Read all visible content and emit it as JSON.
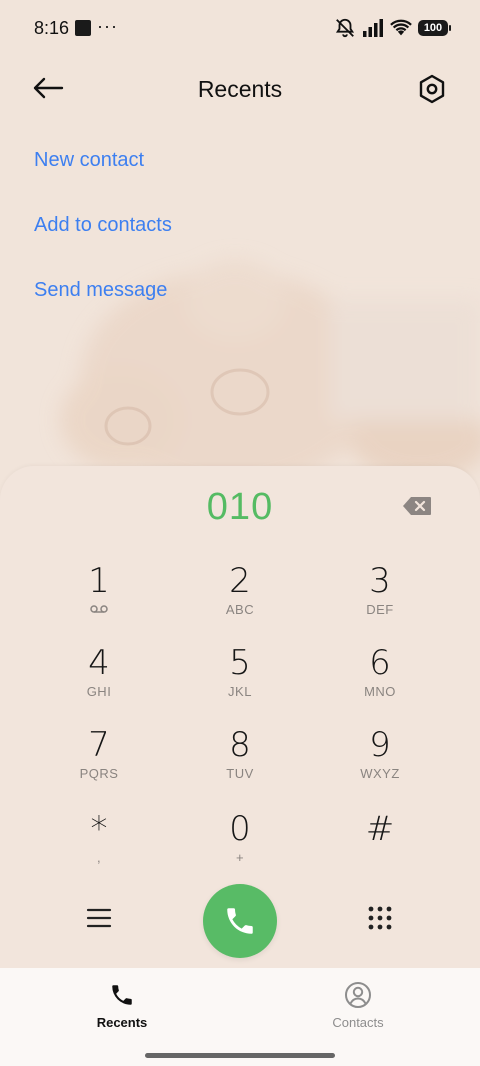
{
  "status_bar": {
    "time": "8:16",
    "overflow_dots": "···",
    "battery": "100",
    "icons": [
      "notification-square-icon",
      "mute-icon",
      "signal-icon",
      "wifi-icon",
      "battery-icon"
    ]
  },
  "header": {
    "title": "Recents",
    "back_icon": "arrow-left-icon",
    "settings_icon": "hexagon-settings-icon"
  },
  "actions": [
    {
      "label": "New contact"
    },
    {
      "label": "Add to contacts"
    },
    {
      "label": "Send message"
    }
  ],
  "dialpad": {
    "number": "010",
    "number_color": "#55bb63",
    "keys": [
      {
        "digit": "1",
        "letters": ""
      },
      {
        "digit": "2",
        "letters": "ABC"
      },
      {
        "digit": "3",
        "letters": "DEF"
      },
      {
        "digit": "4",
        "letters": "GHI"
      },
      {
        "digit": "5",
        "letters": "JKL"
      },
      {
        "digit": "6",
        "letters": "MNO"
      },
      {
        "digit": "7",
        "letters": "PQRS"
      },
      {
        "digit": "8",
        "letters": "TUV"
      },
      {
        "digit": "9",
        "letters": "WXYZ"
      },
      {
        "digit": "*",
        "letters": ","
      },
      {
        "digit": "0",
        "letters": "+"
      },
      {
        "digit": "#",
        "letters": ""
      }
    ],
    "call_color": "#58bb66",
    "icons": [
      "backspace-icon",
      "voicemail-icon",
      "menu-icon",
      "phone-icon",
      "keypad-grid-icon"
    ]
  },
  "bottom_nav": {
    "items": [
      {
        "label": "Recents",
        "icon": "phone-icon",
        "active": true
      },
      {
        "label": "Contacts",
        "icon": "person-circle-icon",
        "active": false
      }
    ]
  },
  "colors": {
    "accent_link": "#3d7ff0",
    "background": "#f1e4da"
  }
}
